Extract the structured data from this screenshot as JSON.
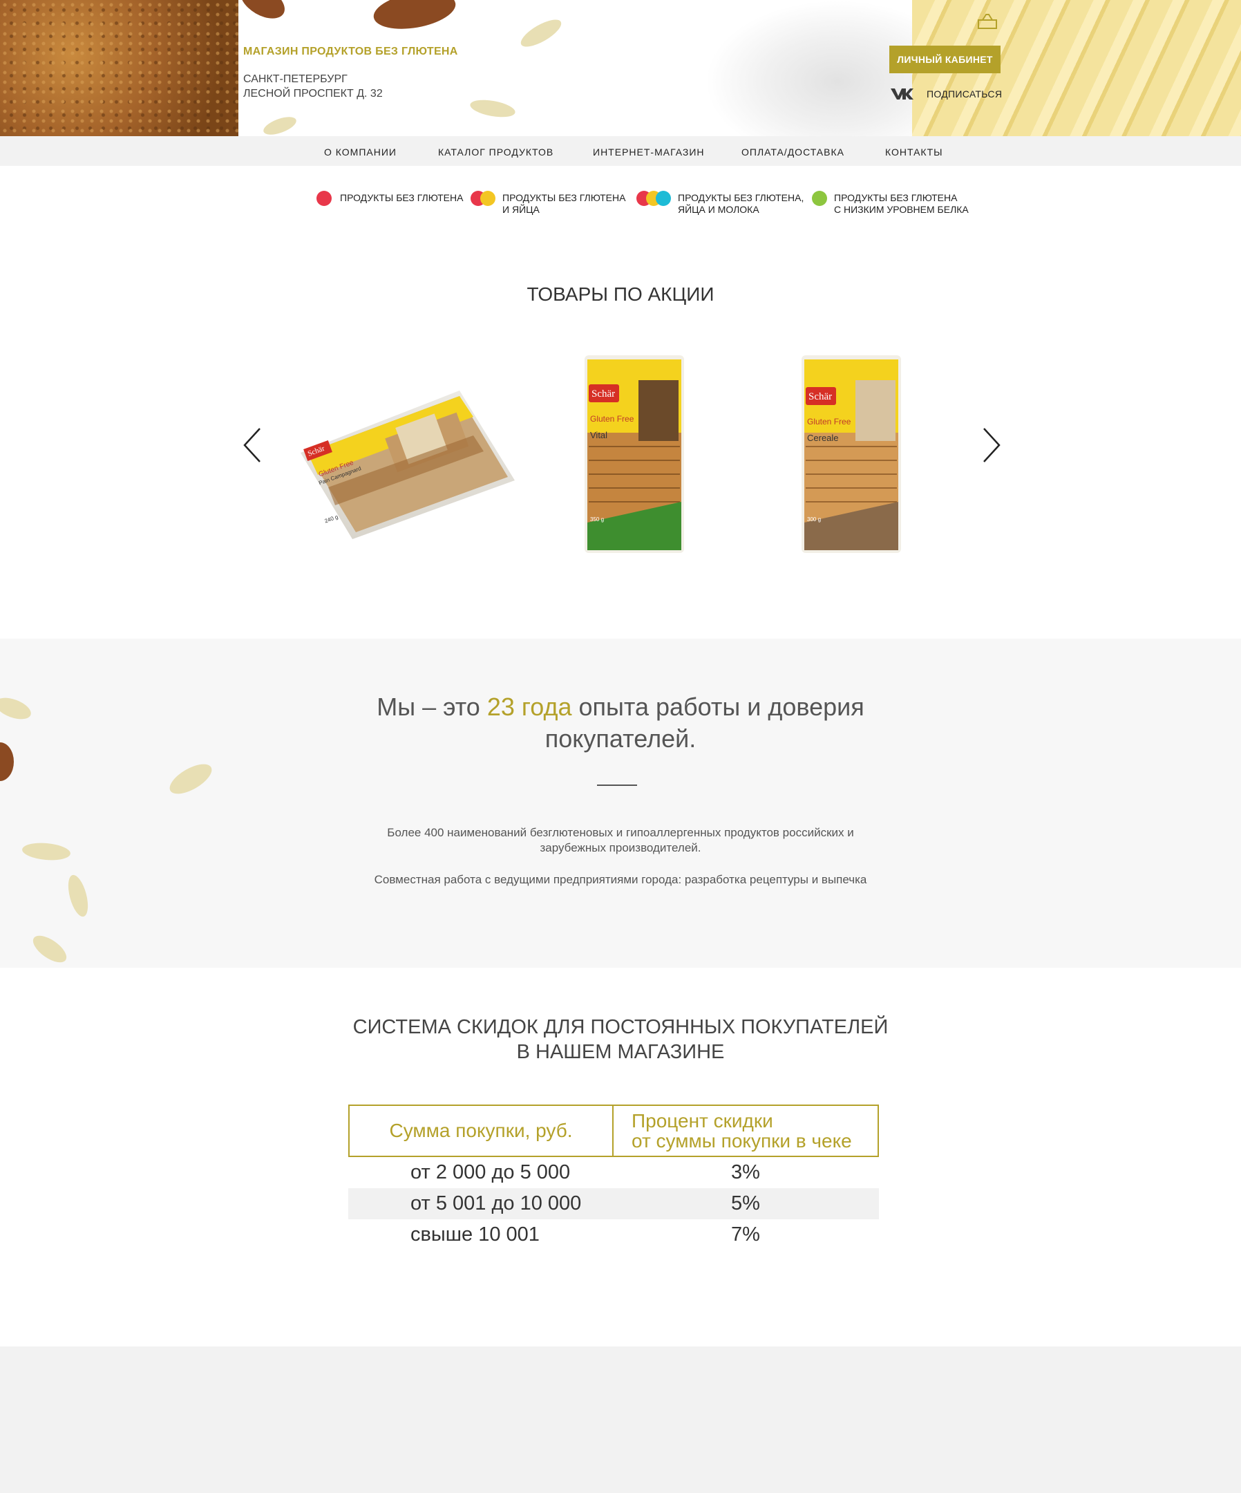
{
  "header": {
    "brand_title": "МАГАЗИН ПРОДУКТОВ БЕЗ ГЛЮТЕНА",
    "address_city": "САНКТ-ПЕТЕРБУРГ",
    "address_street": "ЛЕСНОЙ ПРОСПЕКТ Д. 32",
    "account_button": "ЛИЧНЫЙ КАБИНЕТ",
    "subscribe_label": "ПОДПИСАТЬСЯ",
    "icons": [
      "cart-icon",
      "vk-icon"
    ],
    "brand_color": "#b4a12a"
  },
  "nav": {
    "items": [
      {
        "label": "О КОМПАНИИ"
      },
      {
        "label": "КАТАЛОГ ПРОДУКТОВ"
      },
      {
        "label": "ИНТЕРНЕТ-МАГАЗИН"
      },
      {
        "label": "ОПЛАТА/ДОСТАВКА"
      },
      {
        "label": "КОНТАКТЫ"
      }
    ]
  },
  "legend": [
    {
      "label": "ПРОДУКТЫ БЕЗ ГЛЮТЕНА",
      "colors": [
        "#e8374a"
      ]
    },
    {
      "label": "ПРОДУКТЫ БЕЗ ГЛЮТЕНА\nИ ЯЙЦА",
      "colors": [
        "#e8374a",
        "#f3c623"
      ]
    },
    {
      "label": "ПРОДУКТЫ БЕЗ ГЛЮТЕНА,\nЯЙЦА И МОЛОКА",
      "colors": [
        "#e8374a",
        "#f3c623",
        "#1dbbd6"
      ]
    },
    {
      "label": "ПРОДУКТЫ БЕЗ ГЛЮТЕНА\nС НИЗКИМ УРОВНЕМ БЕЛКА",
      "colors": [
        "#8dc63f"
      ]
    }
  ],
  "promo": {
    "title": "ТОВАРЫ ПО АКЦИИ",
    "products": [
      {
        "brand": "Schär",
        "line1": "Gluten Free",
        "line2": "Pain Campagnard",
        "weight": "240 g"
      },
      {
        "brand": "Schär",
        "line1": "Gluten Free",
        "line2": "Vital",
        "weight": "350 g"
      },
      {
        "brand": "Schär",
        "line1": "Gluten Free",
        "line2": "Cereale",
        "weight": "300 g"
      }
    ]
  },
  "about": {
    "headline_pre": "Мы – это ",
    "headline_highlight": "23 года",
    "headline_post": " опыта работы и доверия",
    "headline_line2": "покупателей.",
    "para1_line1": "Более 400 наименований безглютеновых и гипоаллергенных продуктов российских и",
    "para1_line2": "зарубежных производителей.",
    "para2": "Совместная работа с ведущими предприятиями города: разработка рецептуры и выпечка"
  },
  "discounts": {
    "title_line1": "СИСТЕМА СКИДОК ДЛЯ ПОСТОЯННЫХ ПОКУПАТЕЛЕЙ",
    "title_line2": "В НАШЕМ МАГАЗИНЕ",
    "col1_header": "Сумма покупки, руб.",
    "col2_header": "Процент скидки\nот суммы покупки в чеке",
    "rows": [
      {
        "sum": "от 2 000 до 5 000",
        "percent": "3%"
      },
      {
        "sum": "от 5 001 до 10 000",
        "percent": "5%"
      },
      {
        "sum": "свыше 10 001",
        "percent": "7%"
      }
    ]
  }
}
